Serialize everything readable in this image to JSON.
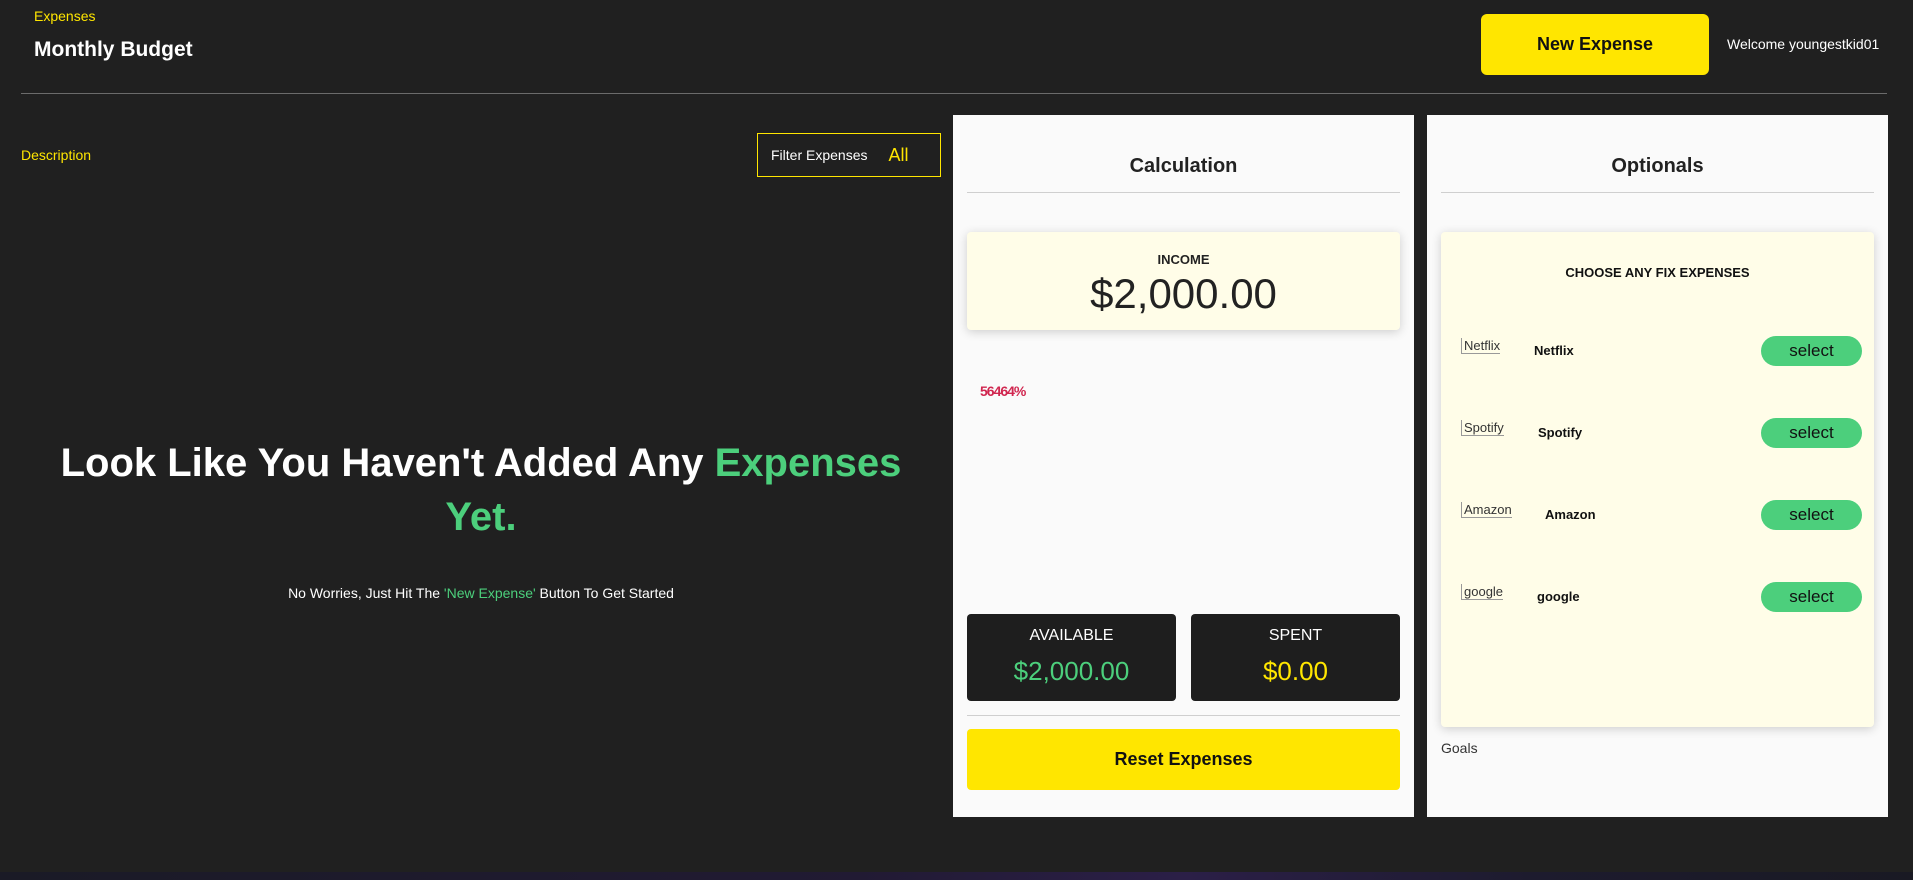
{
  "header": {
    "brand_small": "Expenses",
    "title": "Monthly Budget",
    "new_expense_label": "New Expense",
    "welcome": "Welcome youngestkid01"
  },
  "expenses": {
    "description_label": "Description",
    "filter_label": "Filter Expenses",
    "filter_value": "All",
    "empty_title_main": "Look Like You Haven't Added Any ",
    "empty_title_accent": "Expenses Yet.",
    "empty_sub_before": "No Worries, Just Hit The ",
    "empty_sub_highlight": "'New Expense'",
    "empty_sub_after": " Button To Get Started"
  },
  "calculation": {
    "title": "Calculation",
    "income_label": "INCOME",
    "income_value": "$2,000.00",
    "chart_percent_text": "56464%",
    "available_label": "AVAILABLE",
    "available_value": "$2,000.00",
    "spent_label": "SPENT",
    "spent_value": "$0.00",
    "reset_label": "Reset Expenses"
  },
  "optionals": {
    "title": "Optionals",
    "fix_title": "CHOOSE ANY FIX EXPENSES",
    "items": [
      {
        "alt": "Netflix",
        "name": "Netflix",
        "button": "select"
      },
      {
        "alt": "Spotify",
        "name": "Spotify",
        "button": "select"
      },
      {
        "alt": "Amazon",
        "name": "Amazon",
        "button": "select"
      },
      {
        "alt": "google",
        "name": "google",
        "button": "select"
      }
    ],
    "goals_label": "Goals"
  },
  "colors": {
    "background": "#202020",
    "accent_yellow": "#ffe600",
    "accent_green": "#4ccf7c",
    "panel": "#fafafa",
    "card": "#fffde8"
  }
}
